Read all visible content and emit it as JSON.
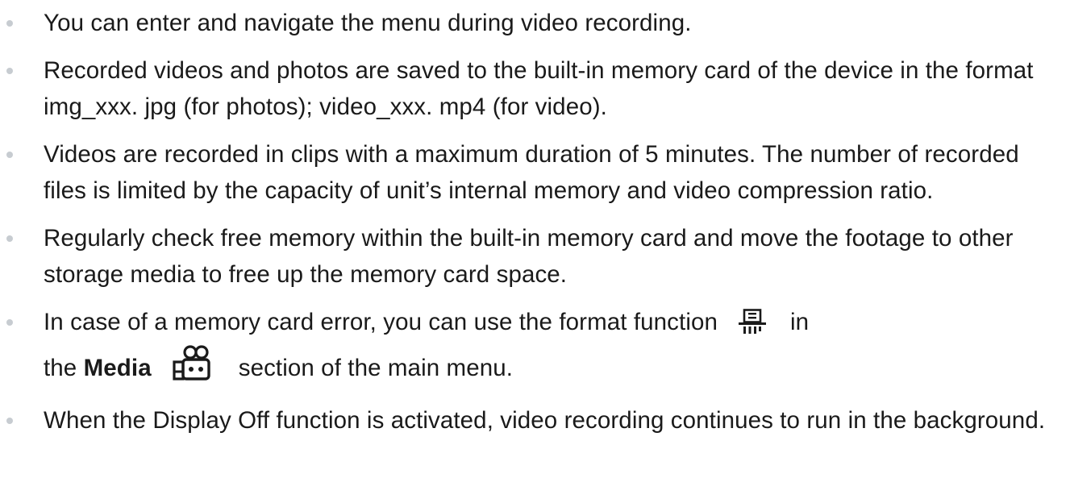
{
  "items": [
    {
      "text": "You can enter and navigate the menu during video recording."
    },
    {
      "text": "Recorded videos and photos are saved to the built-in memory card of the device in the format img_xxx. jpg (for photos); video_xxx. mp4 (for video)."
    },
    {
      "text": "Videos are recorded in clips with a maximum duration of 5 minutes. The number of recorded files is limited by the capacity of unit’s internal memory and video compression ratio."
    },
    {
      "text": "Regularly check free memory within the built-in memory card and move the footage to other storage media to free up the memory card space."
    },
    {
      "part1": "In case of a memory card error, you can use the ",
      "format_function": "format function",
      "format_icon": "format-icon",
      "part2": "in",
      "part3": "the ",
      "media": "Media",
      "media_icon": "media-icon",
      "part4": "section of the main menu."
    },
    {
      "part1": "When the ",
      "display_off": "Display Off",
      "part2": " function is activated, video recording continues to run in the background."
    }
  ]
}
